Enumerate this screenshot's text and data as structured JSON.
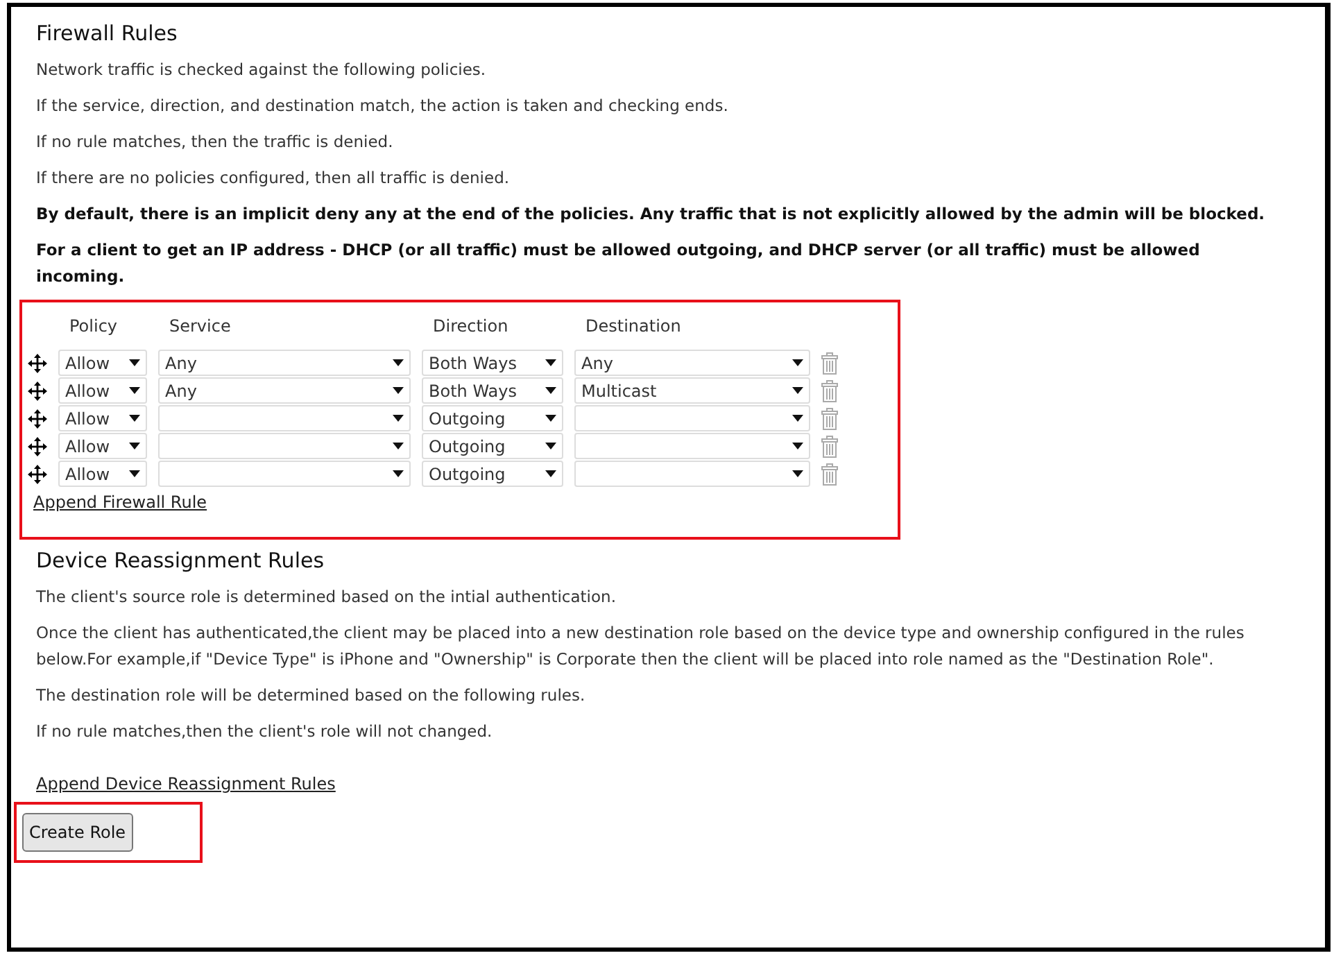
{
  "firewall": {
    "title": "Firewall Rules",
    "paragraphs": [
      {
        "text": "Network traffic is checked against the following policies.",
        "bold": false
      },
      {
        "text": "If the service, direction, and destination match, the action is taken and checking ends.",
        "bold": false
      },
      {
        "text": "If no rule matches, then the traffic is denied.",
        "bold": false
      },
      {
        "text": "If there are no policies configured, then all traffic is denied.",
        "bold": false
      },
      {
        "text": "By default, there is an implicit deny any at the end of the policies. Any traffic that is not explicitly allowed by the admin will be blocked.",
        "bold": true
      },
      {
        "text": "For a client to get an IP address - DHCP (or all traffic) must be allowed outgoing, and DHCP server (or all traffic) must be allowed incoming.",
        "bold": true
      }
    ],
    "columns": [
      "Policy",
      "Service",
      "Direction",
      "Destination"
    ],
    "rows": [
      {
        "policy": "Allow",
        "service": "Any",
        "direction": "Both Ways",
        "destination": "Any"
      },
      {
        "policy": "Allow",
        "service": "Any",
        "direction": "Both Ways",
        "destination": "Multicast"
      },
      {
        "policy": "Allow",
        "direction": "Outgoing"
      },
      {
        "policy": "Allow",
        "direction": "Outgoing"
      },
      {
        "policy": "Allow",
        "direction": "Outgoing"
      }
    ],
    "append_link": "Append Firewall Rule"
  },
  "device": {
    "title": "Device Reassignment Rules",
    "paragraphs": [
      {
        "text": "The client's source role is determined based on the intial authentication.",
        "bold": false
      },
      {
        "text": "Once the client has authenticated,the client may be placed into a new destination role based on the device type and ownership configured in the rules below.For example,if \"Device Type\" is iPhone and \"Ownership\" is Corporate then the client will be placed into role named as the \"Destination Role\".",
        "bold": false
      },
      {
        "text": "The destination role will be determined based on the following rules.",
        "bold": false
      },
      {
        "text": "If no rule matches,then the client's role will not changed.",
        "bold": false
      }
    ],
    "append_link": "Append Device Reassignment Rules"
  },
  "create_button": "Create Role"
}
